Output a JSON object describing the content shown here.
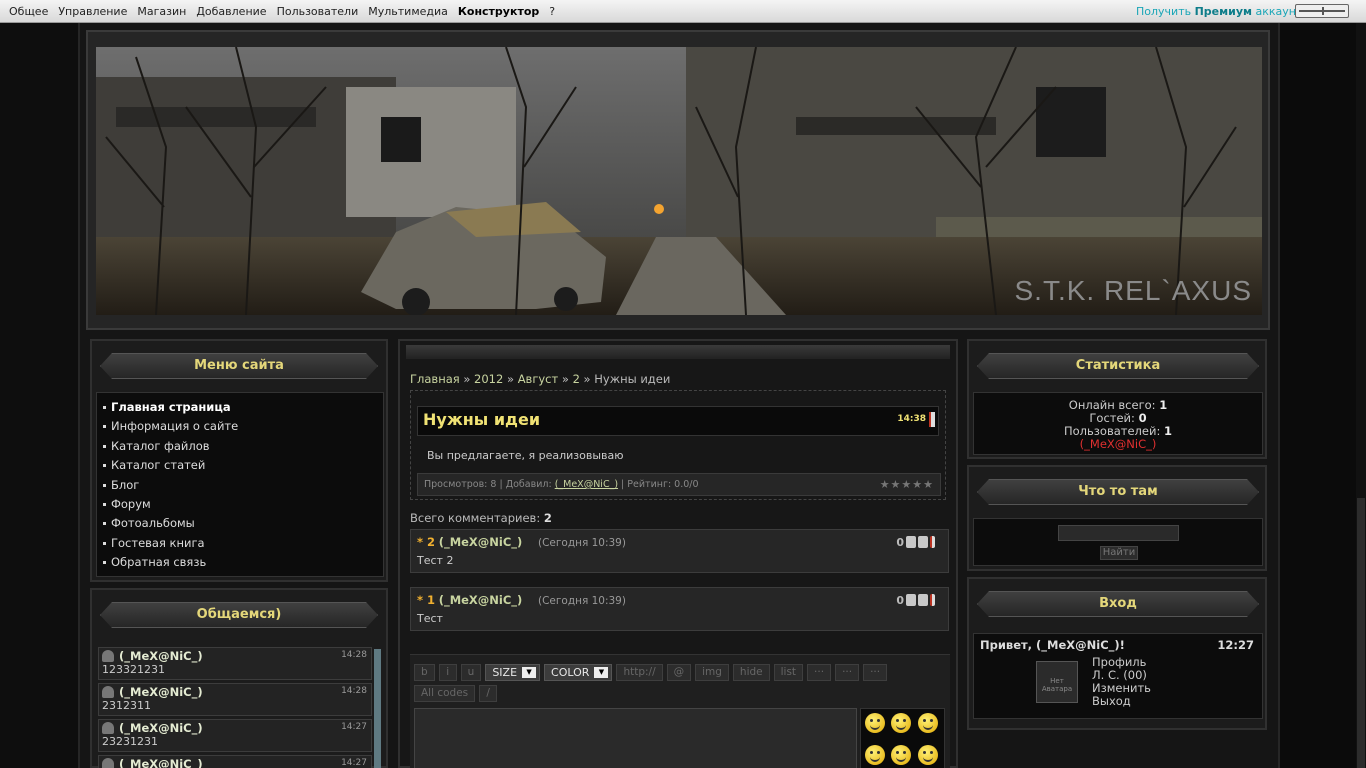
{
  "topbar": {
    "items": [
      "Общее",
      "Управление",
      "Магазин",
      "Добавление",
      "Пользователи",
      "Мультимедиа",
      "Конструктор",
      "?"
    ],
    "premium_prefix": "Получить",
    "premium_bold": "Премиум",
    "premium_suffix": "аккаунт"
  },
  "banner": {
    "logo": "S.T.K. REL`AXUS"
  },
  "site_menu": {
    "title": "Меню сайта",
    "items": [
      "Главная страница",
      "Информация о сайте",
      "Каталог файлов",
      "Каталог статей",
      "Блог",
      "Форум",
      "Фотоальбомы",
      "Гостевая книга",
      "Обратная связь"
    ]
  },
  "chat": {
    "title": "Общаемся)",
    "messages": [
      {
        "user": "(_MeX@NiC_)",
        "time": "14:28",
        "text": "123321231"
      },
      {
        "user": "(_MeX@NiC_)",
        "time": "14:28",
        "text": "2312311"
      },
      {
        "user": "(_MeX@NiC_)",
        "time": "14:27",
        "text": "23231231"
      },
      {
        "user": "(_MeX@NiC_)",
        "time": "14:27",
        "text": ""
      }
    ]
  },
  "breadcrumb": {
    "items": [
      "Главная",
      "2012",
      "Август",
      "2"
    ],
    "current": "Нужны идеи",
    "sep": "»"
  },
  "entry": {
    "title": "Нужны идеи",
    "time": "14:38",
    "text": "Вы предлагаете, я реализовываю",
    "views_label": "Просмотров: 8",
    "added_label": "Добавил:",
    "author": "(_MeX@NiC_)",
    "rating_label": "Рейтинг: 0.0/0",
    "stars": "★★★★★"
  },
  "comments": {
    "count_label": "Всего комментариев:",
    "count": "2",
    "items": [
      {
        "num": "* 2",
        "user": "(_MeX@NiC_)",
        "date": "(Сегодня 10:39)",
        "text": "Тест 2",
        "score": "0"
      },
      {
        "num": "* 1",
        "user": "(_MeX@NiC_)",
        "date": "(Сегодня 10:39)",
        "text": "Тест",
        "score": "0"
      }
    ]
  },
  "editor": {
    "buttons": [
      "b",
      "i",
      "u",
      "SIZE",
      "COLOR",
      "http://",
      "@",
      "img",
      "hide",
      "list",
      "···",
      "···",
      "···",
      "All codes",
      "/"
    ]
  },
  "stats": {
    "title": "Статистика",
    "online_label": "Онлайн всего:",
    "online": "1",
    "guests_label": "Гостей:",
    "guests": "0",
    "users_label": "Пользователей:",
    "users": "1",
    "online_user": "(_MeX@NiC_)"
  },
  "search": {
    "title": "Что то там",
    "button": "Найти"
  },
  "login": {
    "title": "Вход",
    "greeting": "Привет, (_MeX@NiC_)!",
    "time": "12:27",
    "avatar_text": "Нет Аватара",
    "links": [
      "Профиль",
      "Л. С. (00)",
      "Изменить",
      "Выход"
    ]
  }
}
